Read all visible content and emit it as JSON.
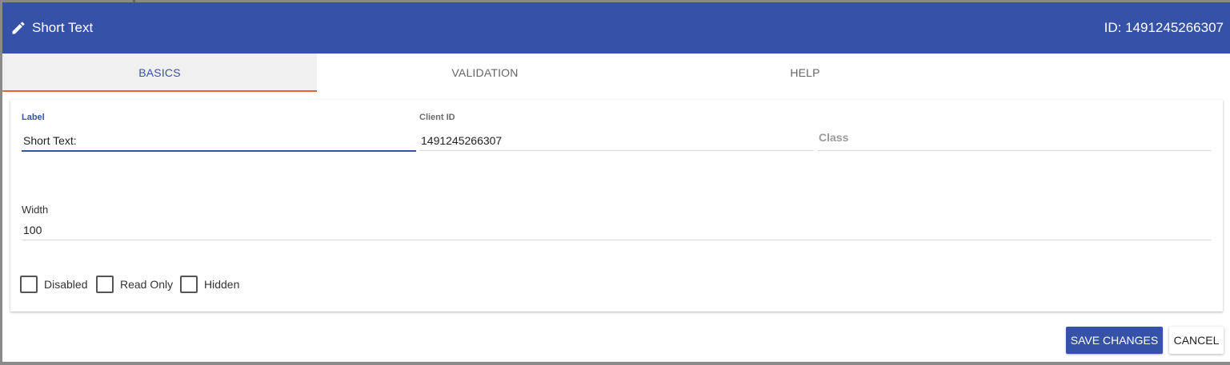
{
  "header": {
    "title": "Short Text",
    "id_text": "ID: 1491245266307",
    "icon": "pencil-icon"
  },
  "tabs": [
    {
      "label": "BASICS",
      "active": true
    },
    {
      "label": "VALIDATION",
      "active": false
    },
    {
      "label": "HELP",
      "active": false
    }
  ],
  "fields": {
    "label": {
      "label": "Label",
      "value": "Short Text:"
    },
    "client_id": {
      "label": "Client ID",
      "value": "1491245266307"
    },
    "class": {
      "placeholder": "Class",
      "value": ""
    },
    "width": {
      "label": "Width",
      "value": "100"
    }
  },
  "checkboxes": [
    {
      "label": "Disabled",
      "checked": false
    },
    {
      "label": "Read Only",
      "checked": false
    },
    {
      "label": "Hidden",
      "checked": false
    }
  ],
  "buttons": {
    "save": "SAVE CHANGES",
    "cancel": "CANCEL"
  },
  "colors": {
    "primary": "#3652a8",
    "tab_indicator": "#e0672c"
  }
}
